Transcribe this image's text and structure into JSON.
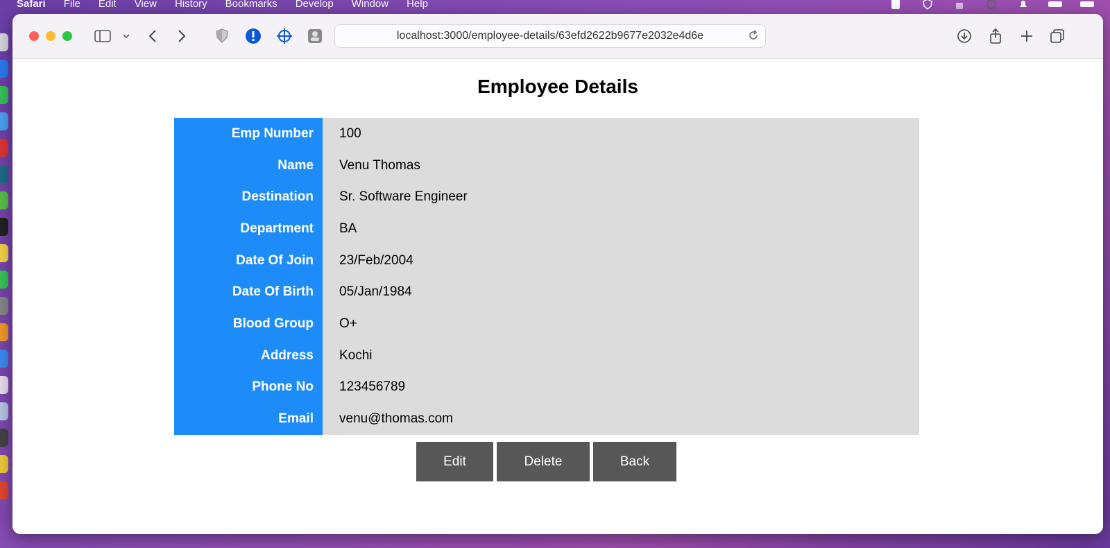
{
  "menubar": {
    "app": "Safari",
    "items": [
      "File",
      "Edit",
      "View",
      "History",
      "Bookmarks",
      "Develop",
      "Window",
      "Help"
    ]
  },
  "browser": {
    "url": "localhost:3000/employee-details/63efd2622b9677e2032e4d6e"
  },
  "page": {
    "title": "Employee Details",
    "rows": [
      {
        "label": "Emp Number",
        "value": "100"
      },
      {
        "label": "Name",
        "value": "Venu Thomas"
      },
      {
        "label": "Destination",
        "value": "Sr. Software Engineer"
      },
      {
        "label": "Department",
        "value": "BA"
      },
      {
        "label": "Date Of Join",
        "value": "23/Feb/2004"
      },
      {
        "label": "Date Of Birth",
        "value": "05/Jan/1984"
      },
      {
        "label": "Blood Group",
        "value": "O+"
      },
      {
        "label": "Address",
        "value": "Kochi"
      },
      {
        "label": "Phone No",
        "value": "123456789"
      },
      {
        "label": "Email",
        "value": "venu@thomas.com"
      }
    ],
    "buttons": {
      "edit": "Edit",
      "delete": "Delete",
      "back": "Back"
    }
  },
  "colors": {
    "label_bg": "#1e8cf8",
    "value_bg": "#dcdcdc",
    "button_bg": "#575757"
  }
}
